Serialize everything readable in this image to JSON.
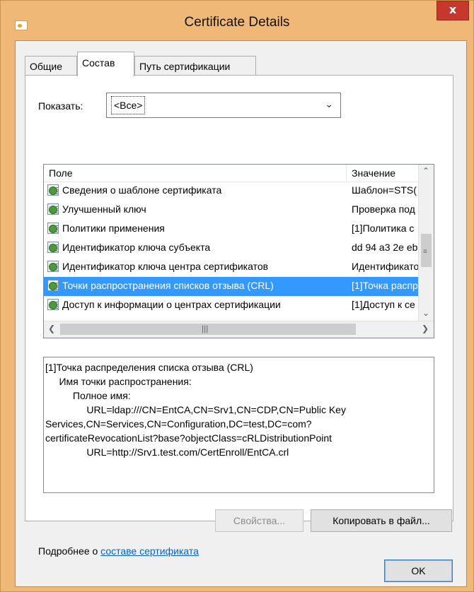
{
  "window": {
    "title": "Certificate Details",
    "close_label": "x"
  },
  "tabs": [
    {
      "label": "Общие"
    },
    {
      "label": "Состав"
    },
    {
      "label": "Путь сертификации"
    }
  ],
  "show": {
    "label": "Показать:",
    "value": "<Все>"
  },
  "list": {
    "headers": {
      "field": "Поле",
      "value": "Значение"
    },
    "rows": [
      {
        "field": "Сведения о шаблоне сертификата",
        "value": "Шаблон=STS("
      },
      {
        "field": "Улучшенный ключ",
        "value": "Проверка под"
      },
      {
        "field": "Политики применения",
        "value": "[1]Политика с"
      },
      {
        "field": "Идентификатор ключа субъекта",
        "value": "dd 94 a3 2e eb"
      },
      {
        "field": "Идентификатор ключа центра сертификатов",
        "value": "Идентификато"
      },
      {
        "field": "Точки распространения списков отзыва (CRL)",
        "value": "[1]Точка распр"
      },
      {
        "field": "Доступ к информации о центрах сертификации",
        "value": "[1]Доступ к се"
      }
    ]
  },
  "detail": {
    "lines": [
      "[1]Точка распределения списка отзыва (CRL)",
      "     Имя точки распространения:",
      "          Полное имя:",
      "               URL=ldap:///CN=EntCA,CN=Srv1,CN=CDP,CN=Public Key",
      "Services,CN=Services,CN=Configuration,DC=test,DC=com?",
      "certificateRevocationList?base?objectClass=cRLDistributionPoint",
      "               URL=http://Srv1.test.com/CertEnroll/EntCA.crl"
    ]
  },
  "buttons": {
    "properties": "Свойства...",
    "copy": "Копировать в файл...",
    "ok": "OK"
  },
  "more": {
    "prefix": "Подробнее о ",
    "link": "составе сертификата"
  }
}
